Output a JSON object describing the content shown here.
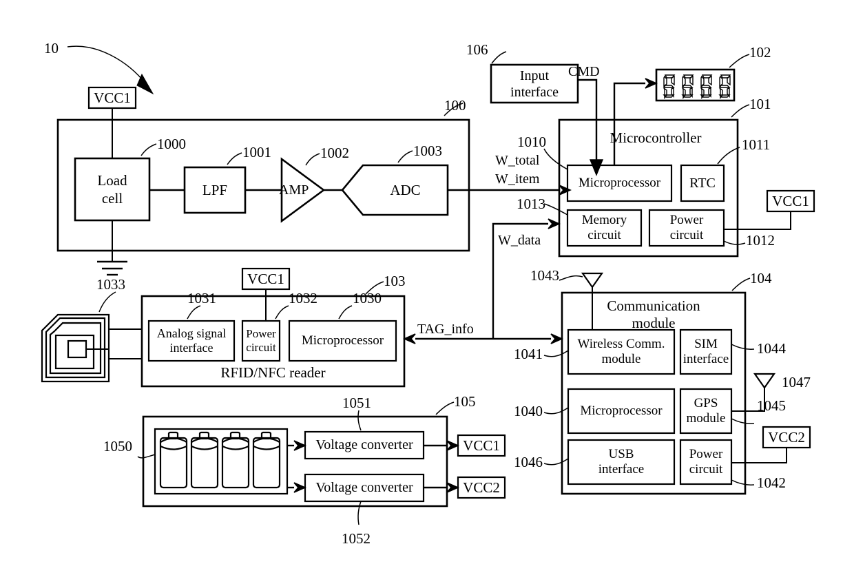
{
  "figure": {
    "system_ref": "10",
    "title_refs": [
      "10",
      "100",
      "101",
      "102",
      "103",
      "104",
      "105",
      "106"
    ]
  },
  "weighing_unit": {
    "ref": "100",
    "supply_label": "VCC1",
    "blocks": [
      {
        "ref": "1000",
        "label_line1": "Load",
        "label_line2": "cell"
      },
      {
        "ref": "1001",
        "label": "LPF"
      },
      {
        "ref": "1002",
        "label": "AMP"
      },
      {
        "ref": "1003",
        "label": "ADC"
      }
    ],
    "ground_icon": "ground-icon"
  },
  "signals": {
    "w_total": "W_total",
    "w_item": "W_item",
    "w_data": "W_data",
    "cmd": "CMD",
    "tag_info": "TAG_info"
  },
  "input_interface": {
    "ref": "106",
    "label_line1": "Input",
    "label_line2": "interface"
  },
  "display": {
    "ref": "102",
    "type": "seven-segment-display",
    "digits": "8888",
    "digit_count": 4
  },
  "microcontroller": {
    "ref": "101",
    "title": "Microcontroller",
    "supply_label": "VCC1",
    "blocks": [
      {
        "ref": "1010",
        "label": "Microprocessor"
      },
      {
        "ref": "1011",
        "label": "RTC"
      },
      {
        "ref": "1013",
        "label_line1": "Memory",
        "label_line2": "circuit"
      },
      {
        "ref": "1012",
        "label_line1": "Power",
        "label_line2": "circuit"
      }
    ]
  },
  "rfid_reader": {
    "ref": "103",
    "title": "RFID/NFC reader",
    "supply_label": "VCC1",
    "antenna": {
      "ref": "1033",
      "name": "rfid-coil-antenna-icon"
    },
    "blocks": [
      {
        "ref": "1031",
        "label_line1": "Analog signal",
        "label_line2": "interface"
      },
      {
        "ref": "1032",
        "label_line1": "Power",
        "label_line2": "circuit"
      },
      {
        "ref": "1030",
        "label": "Microprocessor"
      }
    ]
  },
  "communication_module": {
    "ref": "104",
    "title_line1": "Communication",
    "title_line2": "module",
    "supply_label": "VCC2",
    "antennas": [
      {
        "ref": "1043",
        "name": "wireless-antenna-icon"
      },
      {
        "ref": "1047",
        "name": "gps-antenna-icon"
      }
    ],
    "blocks": [
      {
        "ref": "1041",
        "label_line1": "Wireless Comm.",
        "label_line2": "module"
      },
      {
        "ref": "1044",
        "label_line1": "SIM",
        "label_line2": "interface"
      },
      {
        "ref": "1040",
        "label": "Microprocessor"
      },
      {
        "ref": "1045",
        "label_line1": "GPS",
        "label_line2": "module"
      },
      {
        "ref": "1046",
        "label_line1": "USB",
        "label_line2": "interface"
      },
      {
        "ref": "1042",
        "label_line1": "Power",
        "label_line2": "circuit"
      }
    ]
  },
  "power_unit": {
    "ref": "105",
    "battery": {
      "ref": "1050",
      "name": "battery-pack-icon",
      "cell_count": 4
    },
    "converters": [
      {
        "ref": "1051",
        "label": "Voltage converter",
        "output": "VCC1"
      },
      {
        "ref": "1052",
        "label": "Voltage converter",
        "output": "VCC2"
      }
    ],
    "outputs": [
      "VCC1",
      "VCC2"
    ]
  },
  "colors": {
    "ink": "#000000",
    "paper": "#ffffff"
  }
}
